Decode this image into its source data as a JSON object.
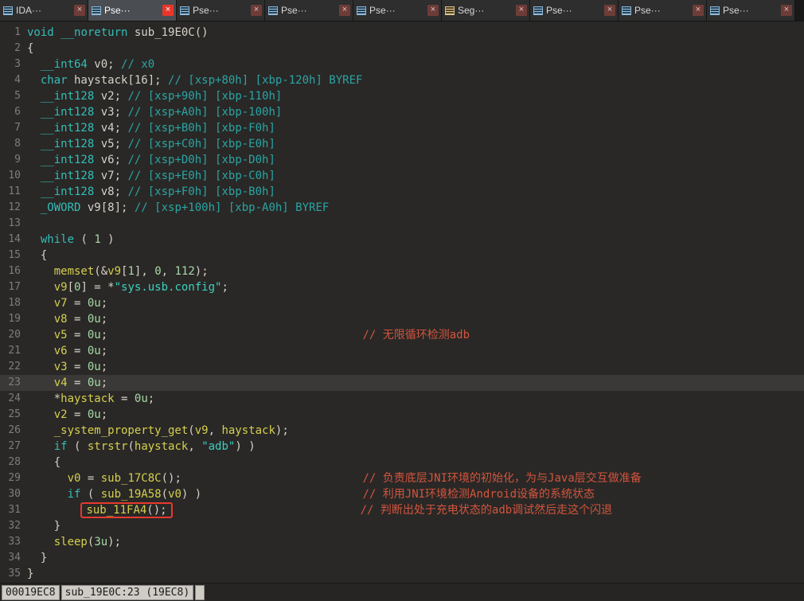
{
  "palette": {
    "background": "#292826",
    "keyword": "#33bdb8",
    "variable": "#d6cf4f",
    "number": "#a8d8a8",
    "string": "#3ecfc0",
    "auto_comment": "#2ba4a4",
    "user_comment": "#d2543e",
    "highlight_box": "#e8392e",
    "active_tab_close": "#e8362a",
    "current_line": "#3a3937"
  },
  "tabs": [
    {
      "label": "IDA···",
      "type": "ida-view",
      "active": false
    },
    {
      "label": "Pse···",
      "type": "pseudocode",
      "active": true
    },
    {
      "label": "Pse···",
      "type": "pseudocode",
      "active": false
    },
    {
      "label": "Pse···",
      "type": "pseudocode",
      "active": false
    },
    {
      "label": "Pse···",
      "type": "pseudocode",
      "active": false
    },
    {
      "label": "Seg···",
      "type": "segments",
      "active": false
    },
    {
      "label": "Pse···",
      "type": "pseudocode",
      "active": false
    },
    {
      "label": "Pse···",
      "type": "pseudocode",
      "active": false
    },
    {
      "label": "Pse···",
      "type": "pseudocode",
      "active": false
    }
  ],
  "editor": {
    "lines": [
      {
        "no": 1,
        "tokens": [
          [
            "k",
            "void"
          ],
          [
            "p",
            " "
          ],
          [
            "k",
            "__noreturn"
          ],
          [
            "p",
            " sub_19E0C()"
          ]
        ]
      },
      {
        "no": 2,
        "tokens": [
          [
            "p",
            "{"
          ]
        ]
      },
      {
        "no": 3,
        "tokens": [
          [
            "p",
            "  "
          ],
          [
            "k",
            "__int64"
          ],
          [
            "p",
            " v0; "
          ],
          [
            "c",
            "// x0"
          ]
        ]
      },
      {
        "no": 4,
        "tokens": [
          [
            "p",
            "  "
          ],
          [
            "k",
            "char"
          ],
          [
            "p",
            " haystack[16]; "
          ],
          [
            "c",
            "// [xsp+80h] [xbp-120h] BYREF"
          ]
        ]
      },
      {
        "no": 5,
        "tokens": [
          [
            "p",
            "  "
          ],
          [
            "k",
            "__int128"
          ],
          [
            "p",
            " v2; "
          ],
          [
            "c",
            "// [xsp+90h] [xbp-110h]"
          ]
        ]
      },
      {
        "no": 6,
        "tokens": [
          [
            "p",
            "  "
          ],
          [
            "k",
            "__int128"
          ],
          [
            "p",
            " v3; "
          ],
          [
            "c",
            "// [xsp+A0h] [xbp-100h]"
          ]
        ]
      },
      {
        "no": 7,
        "tokens": [
          [
            "p",
            "  "
          ],
          [
            "k",
            "__int128"
          ],
          [
            "p",
            " v4; "
          ],
          [
            "c",
            "// [xsp+B0h] [xbp-F0h]"
          ]
        ]
      },
      {
        "no": 8,
        "tokens": [
          [
            "p",
            "  "
          ],
          [
            "k",
            "__int128"
          ],
          [
            "p",
            " v5; "
          ],
          [
            "c",
            "// [xsp+C0h] [xbp-E0h]"
          ]
        ]
      },
      {
        "no": 9,
        "tokens": [
          [
            "p",
            "  "
          ],
          [
            "k",
            "__int128"
          ],
          [
            "p",
            " v6; "
          ],
          [
            "c",
            "// [xsp+D0h] [xbp-D0h]"
          ]
        ]
      },
      {
        "no": 10,
        "tokens": [
          [
            "p",
            "  "
          ],
          [
            "k",
            "__int128"
          ],
          [
            "p",
            " v7; "
          ],
          [
            "c",
            "// [xsp+E0h] [xbp-C0h]"
          ]
        ]
      },
      {
        "no": 11,
        "tokens": [
          [
            "p",
            "  "
          ],
          [
            "k",
            "__int128"
          ],
          [
            "p",
            " v8; "
          ],
          [
            "c",
            "// [xsp+F0h] [xbp-B0h]"
          ]
        ]
      },
      {
        "no": 12,
        "tokens": [
          [
            "p",
            "  "
          ],
          [
            "k",
            "_OWORD"
          ],
          [
            "p",
            " v9[8]; "
          ],
          [
            "c",
            "// [xsp+100h] [xbp-A0h] BYREF"
          ]
        ]
      },
      {
        "no": 13,
        "tokens": []
      },
      {
        "no": 14,
        "tokens": [
          [
            "p",
            "  "
          ],
          [
            "k",
            "while"
          ],
          [
            "p",
            " ( "
          ],
          [
            "n",
            "1"
          ],
          [
            "p",
            " )"
          ]
        ]
      },
      {
        "no": 15,
        "tokens": [
          [
            "p",
            "  {"
          ]
        ]
      },
      {
        "no": 16,
        "tokens": [
          [
            "p",
            "    "
          ],
          [
            "f",
            "memset"
          ],
          [
            "p",
            "(&"
          ],
          [
            "v",
            "v9"
          ],
          [
            "p",
            "["
          ],
          [
            "n",
            "1"
          ],
          [
            "p",
            "], "
          ],
          [
            "n",
            "0"
          ],
          [
            "p",
            ", "
          ],
          [
            "n",
            "112"
          ],
          [
            "p",
            ");"
          ]
        ]
      },
      {
        "no": 17,
        "tokens": [
          [
            "p",
            "    "
          ],
          [
            "v",
            "v9"
          ],
          [
            "p",
            "["
          ],
          [
            "n",
            "0"
          ],
          [
            "p",
            "] = *"
          ],
          [
            "s",
            "\"sys.usb.config\""
          ],
          [
            "p",
            ";"
          ]
        ]
      },
      {
        "no": 18,
        "tokens": [
          [
            "p",
            "    "
          ],
          [
            "v",
            "v7"
          ],
          [
            "p",
            " = "
          ],
          [
            "n",
            "0u"
          ],
          [
            "p",
            ";"
          ]
        ]
      },
      {
        "no": 19,
        "tokens": [
          [
            "p",
            "    "
          ],
          [
            "v",
            "v8"
          ],
          [
            "p",
            " = "
          ],
          [
            "n",
            "0u"
          ],
          [
            "p",
            ";"
          ]
        ]
      },
      {
        "no": 20,
        "tokens": [
          [
            "p",
            "    "
          ],
          [
            "v",
            "v5"
          ],
          [
            "p",
            " = "
          ],
          [
            "n",
            "0u"
          ],
          [
            "p",
            ";"
          ],
          [
            "p",
            "                                      "
          ],
          [
            "u",
            "// 无限循环检测adb"
          ]
        ]
      },
      {
        "no": 21,
        "tokens": [
          [
            "p",
            "    "
          ],
          [
            "v",
            "v6"
          ],
          [
            "p",
            " = "
          ],
          [
            "n",
            "0u"
          ],
          [
            "p",
            ";"
          ]
        ]
      },
      {
        "no": 22,
        "tokens": [
          [
            "p",
            "    "
          ],
          [
            "v",
            "v3"
          ],
          [
            "p",
            " = "
          ],
          [
            "n",
            "0u"
          ],
          [
            "p",
            ";"
          ]
        ]
      },
      {
        "no": 23,
        "highlight": true,
        "tokens": [
          [
            "p",
            "    "
          ],
          [
            "v",
            "v4"
          ],
          [
            "p",
            " = "
          ],
          [
            "n",
            "0u"
          ],
          [
            "p",
            ";"
          ]
        ]
      },
      {
        "no": 24,
        "tokens": [
          [
            "p",
            "    *"
          ],
          [
            "v",
            "haystack"
          ],
          [
            "p",
            " = "
          ],
          [
            "n",
            "0u"
          ],
          [
            "p",
            ";"
          ]
        ]
      },
      {
        "no": 25,
        "tokens": [
          [
            "p",
            "    "
          ],
          [
            "v",
            "v2"
          ],
          [
            "p",
            " = "
          ],
          [
            "n",
            "0u"
          ],
          [
            "p",
            ";"
          ]
        ]
      },
      {
        "no": 26,
        "tokens": [
          [
            "p",
            "    "
          ],
          [
            "f",
            "_system_property_get"
          ],
          [
            "p",
            "("
          ],
          [
            "v",
            "v9"
          ],
          [
            "p",
            ", "
          ],
          [
            "v",
            "haystack"
          ],
          [
            "p",
            ");"
          ]
        ]
      },
      {
        "no": 27,
        "tokens": [
          [
            "p",
            "    "
          ],
          [
            "k",
            "if"
          ],
          [
            "p",
            " ( "
          ],
          [
            "f",
            "strstr"
          ],
          [
            "p",
            "("
          ],
          [
            "v",
            "haystack"
          ],
          [
            "p",
            ", "
          ],
          [
            "s",
            "\"adb\""
          ],
          [
            "p",
            ") )"
          ]
        ]
      },
      {
        "no": 28,
        "tokens": [
          [
            "p",
            "    {"
          ]
        ]
      },
      {
        "no": 29,
        "tokens": [
          [
            "p",
            "      "
          ],
          [
            "v",
            "v0"
          ],
          [
            "p",
            " = "
          ],
          [
            "f",
            "sub_17C8C"
          ],
          [
            "p",
            "();"
          ],
          [
            "p",
            "                           "
          ],
          [
            "u",
            "// 负责底层JNI环境的初始化，为与Java层交互做准备"
          ]
        ]
      },
      {
        "no": 30,
        "tokens": [
          [
            "p",
            "      "
          ],
          [
            "k",
            "if"
          ],
          [
            "p",
            " ( "
          ],
          [
            "f",
            "sub_19A58"
          ],
          [
            "p",
            "("
          ],
          [
            "v",
            "v0"
          ],
          [
            "p",
            ") )"
          ],
          [
            "p",
            "                        "
          ],
          [
            "u",
            "// 利用JNI环境检测Android设备的系统状态"
          ]
        ]
      },
      {
        "no": 31,
        "tokens": [
          [
            "p",
            "        "
          ],
          [
            "f",
            "sub_11FA4",
            "box"
          ],
          [
            "p",
            "();",
            "box"
          ],
          [
            "p",
            "                            "
          ],
          [
            "u",
            "// 判断出处于充电状态的adb调试然后走这个闪退"
          ]
        ]
      },
      {
        "no": 32,
        "tokens": [
          [
            "p",
            "    }"
          ]
        ]
      },
      {
        "no": 33,
        "tokens": [
          [
            "p",
            "    "
          ],
          [
            "f",
            "sleep"
          ],
          [
            "p",
            "("
          ],
          [
            "n",
            "3u"
          ],
          [
            "p",
            ");"
          ]
        ]
      },
      {
        "no": 34,
        "tokens": [
          [
            "p",
            "  }"
          ]
        ]
      },
      {
        "no": 35,
        "tokens": [
          [
            "p",
            "}"
          ]
        ]
      }
    ]
  },
  "statusbar": {
    "address": "00019EC8",
    "location": "sub_19E0C:23 (19EC8)"
  }
}
